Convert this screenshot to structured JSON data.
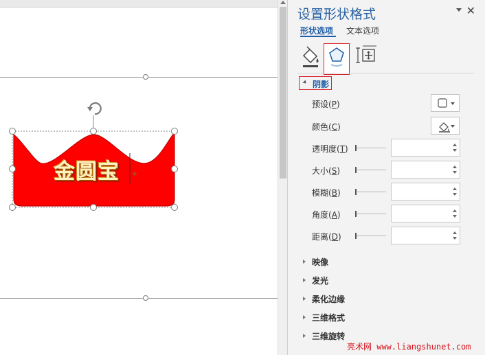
{
  "canvas": {
    "shape_text": "金圆宝",
    "shape_fill": "#ff0000",
    "shape_border": "#c00000"
  },
  "pane": {
    "title": "设置形状格式",
    "close_icon": "close-icon",
    "tabs": [
      {
        "label": "形状选项",
        "selected": true
      },
      {
        "label": "文本选项",
        "selected": false
      }
    ],
    "icon_tabs": [
      {
        "name": "fill-line-icon"
      },
      {
        "name": "effects-icon",
        "selected": true
      },
      {
        "name": "size-properties-icon"
      }
    ],
    "shadow": {
      "title": "阴影",
      "expanded": true,
      "rows": [
        {
          "label": "预设",
          "key": "P",
          "kind": "dropdown"
        },
        {
          "label": "颜色",
          "key": "C",
          "kind": "dropdown"
        },
        {
          "label": "透明度",
          "key": "T",
          "kind": "spinner",
          "value": ""
        },
        {
          "label": "大小",
          "key": "S",
          "kind": "spinner",
          "value": ""
        },
        {
          "label": "模糊",
          "key": "B",
          "kind": "spinner",
          "value": ""
        },
        {
          "label": "角度",
          "key": "A",
          "kind": "spinner",
          "value": ""
        },
        {
          "label": "距离",
          "key": "D",
          "kind": "spinner",
          "value": ""
        }
      ]
    },
    "sections": [
      {
        "label": "映像"
      },
      {
        "label": "发光"
      },
      {
        "label": "柔化边缘"
      },
      {
        "label": "三维格式"
      },
      {
        "label": "三维旋转"
      }
    ]
  },
  "watermark": "亮术网 www.liangshunet.com"
}
